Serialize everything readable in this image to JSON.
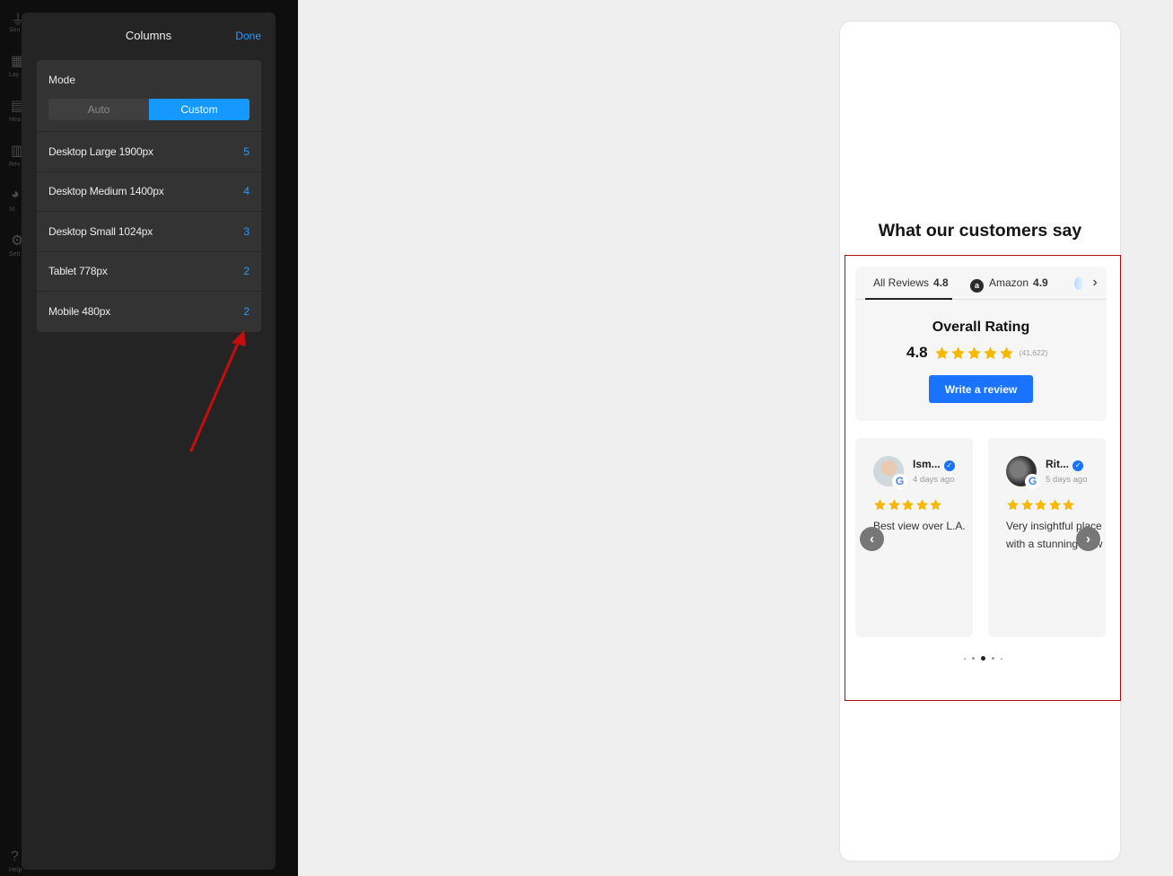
{
  "rail": {
    "items": [
      {
        "icon": "plug-icon",
        "label": "Sou"
      },
      {
        "icon": "layout-icon",
        "label": "Lay"
      },
      {
        "icon": "header-icon",
        "label": "Hea"
      },
      {
        "icon": "reviews-icon",
        "label": "Rev"
      },
      {
        "icon": "style-icon",
        "label": "St"
      },
      {
        "icon": "gear-icon",
        "label": "Sett"
      }
    ],
    "bottom_label": "Help"
  },
  "panel": {
    "title": "Columns",
    "done_label": "Done",
    "mode_label": "Mode",
    "mode_options": [
      "Auto",
      "Custom"
    ],
    "mode_selected": "Custom",
    "breakpoints": [
      {
        "label": "Desktop Large 1900px",
        "value": "5"
      },
      {
        "label": "Desktop Medium 1400px",
        "value": "4"
      },
      {
        "label": "Desktop Small 1024px",
        "value": "3"
      },
      {
        "label": "Tablet 778px",
        "value": "2"
      },
      {
        "label": "Mobile 480px",
        "value": "2"
      }
    ]
  },
  "preview": {
    "section_title": "What our customers say",
    "tabs": [
      {
        "label": "All Reviews",
        "rating": "4.8"
      },
      {
        "label": "Amazon",
        "rating": "4.9"
      }
    ],
    "amazon_badge": "a",
    "overall_title": "Overall Rating",
    "overall_rating": "4.8",
    "overall_stars": 5,
    "review_count": "(41,622)",
    "write_review_label": "Write a review",
    "reviews": [
      {
        "name": "Ism...",
        "time": "4 days ago",
        "stars": 5,
        "text": "Best view over L.A."
      },
      {
        "name": "Rit...",
        "time": "5 days ago",
        "stars": 5,
        "text": "Very insightful place with a stunning view"
      }
    ],
    "google_badge": "G",
    "dots_count": 5,
    "active_dot": 2,
    "colors": {
      "accent": "#1a73ff",
      "star": "#f6b800",
      "frame": "#a80e0e",
      "done": "#2d9bff"
    }
  }
}
